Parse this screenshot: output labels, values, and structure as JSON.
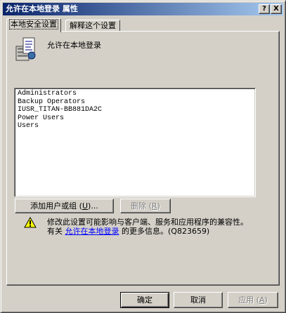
{
  "window": {
    "title": "允许在本地登录 属性",
    "help_label": "?",
    "close_label": "X"
  },
  "tabs": [
    {
      "label": "本地安全设置"
    },
    {
      "label": "解释这个设置"
    }
  ],
  "policy": {
    "title": "允许在本地登录",
    "icon": "policy-server-icon"
  },
  "members": [
    "Administrators",
    "Backup Operators",
    "IUSR_TITAN-BB881DA2C",
    "Power Users",
    "Users"
  ],
  "buttons": {
    "add_prefix": "添加用户或组 (",
    "add_key": "U",
    "add_suffix": ")...",
    "remove_prefix": "删除 (",
    "remove_key": "R",
    "remove_suffix": ")",
    "ok": "确定",
    "cancel": "取消",
    "apply_prefix": "应用 (",
    "apply_key": "A",
    "apply_suffix": ")"
  },
  "warning": {
    "icon": "warning-icon",
    "line1": "修改此设置可能影响与客户端、服务和应用程序的兼容性。",
    "line2_prefix": "有关 ",
    "link": "允许在本地登录",
    "line2_suffix": " 的更多信息。(Q823659)"
  }
}
